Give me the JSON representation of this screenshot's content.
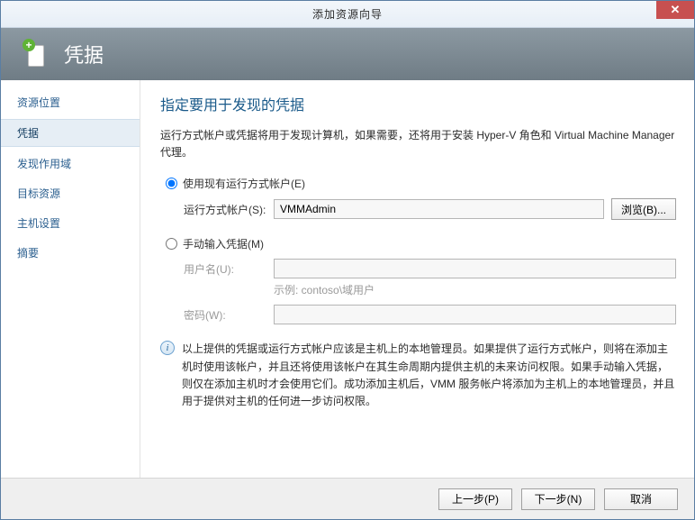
{
  "window": {
    "title": "添加资源向导",
    "close_glyph": "✕"
  },
  "header": {
    "title": "凭据",
    "icon_plus": "+"
  },
  "sidebar": {
    "items": [
      {
        "label": "资源位置"
      },
      {
        "label": "凭据"
      },
      {
        "label": "发现作用域"
      },
      {
        "label": "目标资源"
      },
      {
        "label": "主机设置"
      },
      {
        "label": "摘要"
      }
    ],
    "active_index": 1
  },
  "content": {
    "heading": "指定要用于发现的凭据",
    "description": "运行方式帐户或凭据将用于发现计算机，如果需要，还将用于安装 Hyper-V 角色和 Virtual Machine Manager 代理。",
    "option_use_runas": "使用现有运行方式帐户(E)",
    "runas_label": "运行方式帐户(S):",
    "runas_value": "VMMAdmin",
    "browse_label": "浏览(B)...",
    "option_manual": "手动输入凭据(M)",
    "username_label": "用户名(U):",
    "username_value": "",
    "example_text": "示例: contoso\\域用户",
    "password_label": "密码(W):",
    "password_value": "",
    "info_text": "以上提供的凭据或运行方式帐户应该是主机上的本地管理员。如果提供了运行方式帐户，则将在添加主机时使用该帐户，并且还将使用该帐户在其生命周期内提供主机的未来访问权限。如果手动输入凭据，则仅在添加主机时才会使用它们。成功添加主机后，VMM 服务帐户将添加为主机上的本地管理员，并且用于提供对主机的任何进一步访问权限。",
    "info_glyph": "i"
  },
  "footer": {
    "prev": "上一步(P)",
    "next": "下一步(N)",
    "cancel": "取消"
  }
}
